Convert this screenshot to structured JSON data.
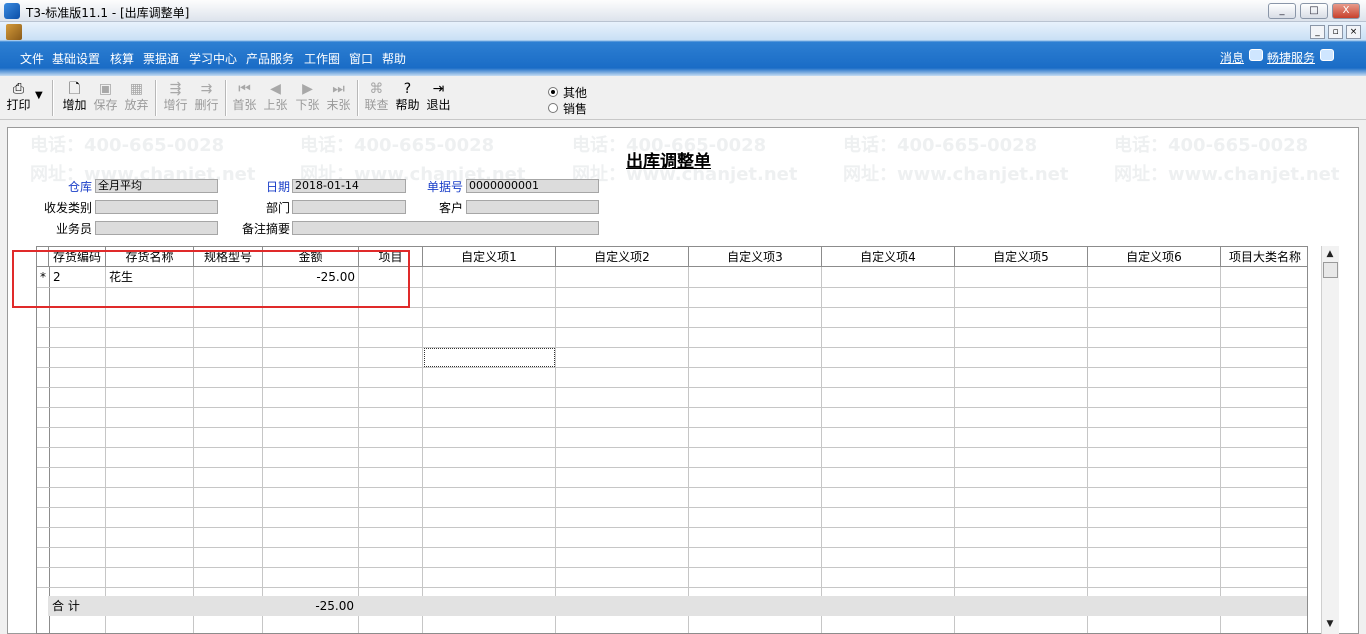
{
  "window": {
    "title": "T3-标准版11.1 - [出库调整单]",
    "buttons": [
      "_",
      "□",
      "X"
    ],
    "mdi_buttons": [
      "_",
      "▫",
      "×"
    ]
  },
  "menu": {
    "items": [
      "文件",
      "基础设置",
      "核算",
      "票据通",
      "学习中心",
      "产品服务",
      "工作圈",
      "窗口",
      "帮助"
    ],
    "right": {
      "messages": "消息",
      "service": "畅捷服务"
    }
  },
  "toolbar": {
    "buttons": [
      {
        "label": "打印",
        "icon": "printer-icon",
        "enabled": true
      },
      {
        "label": "增加",
        "icon": "add-document-icon",
        "enabled": true
      },
      {
        "label": "保存",
        "icon": "save-icon",
        "enabled": false
      },
      {
        "label": "放弃",
        "icon": "discard-icon",
        "enabled": false
      },
      {
        "label": "增行",
        "icon": "insert-row-icon",
        "enabled": false
      },
      {
        "label": "删行",
        "icon": "delete-row-icon",
        "enabled": false
      },
      {
        "label": "首张",
        "icon": "first-record-icon",
        "enabled": false
      },
      {
        "label": "上张",
        "icon": "previous-record-icon",
        "enabled": false
      },
      {
        "label": "下张",
        "icon": "next-record-icon",
        "enabled": false
      },
      {
        "label": "末张",
        "icon": "last-record-icon",
        "enabled": false
      },
      {
        "label": "联查",
        "icon": "linked-query-icon",
        "enabled": false
      },
      {
        "label": "帮助",
        "icon": "help-icon",
        "enabled": true
      },
      {
        "label": "退出",
        "icon": "exit-icon",
        "enabled": true
      }
    ],
    "radio": [
      {
        "label": "其他",
        "checked": true
      },
      {
        "label": "销售",
        "checked": false
      }
    ]
  },
  "form": {
    "title": "出库调整单",
    "fields": {
      "warehouse": {
        "label": "仓库",
        "value": "全月平均"
      },
      "date": {
        "label": "日期",
        "value": "2018-01-14"
      },
      "doc_no": {
        "label": "单据号",
        "value": "0000000001"
      },
      "io_type": {
        "label": "收发类别",
        "value": ""
      },
      "dept": {
        "label": "部门",
        "value": ""
      },
      "customer": {
        "label": "客户",
        "value": ""
      },
      "salesman": {
        "label": "业务员",
        "value": ""
      },
      "remark": {
        "label": "备注摘要",
        "value": ""
      }
    }
  },
  "grid": {
    "columns": [
      "存货编码",
      "存货名称",
      "规格型号",
      "金额",
      "项目",
      "自定义项1",
      "自定义项2",
      "自定义项3",
      "自定义项4",
      "自定义项5",
      "自定义项6",
      "项目大类名称"
    ],
    "rows": [
      {
        "marker": "*",
        "code": "2",
        "name": "花生",
        "spec": "",
        "amount": "-25.00"
      }
    ],
    "total_label": "合  计",
    "total_amount": "-25.00"
  },
  "watermark": {
    "phone": "电话：400-665-0028",
    "site": "网址：www.chanjet.net"
  },
  "colors": {
    "menubar": "#1a6cc6",
    "highlight": "#e02a2a",
    "label_blue": "#1a3ec8"
  }
}
